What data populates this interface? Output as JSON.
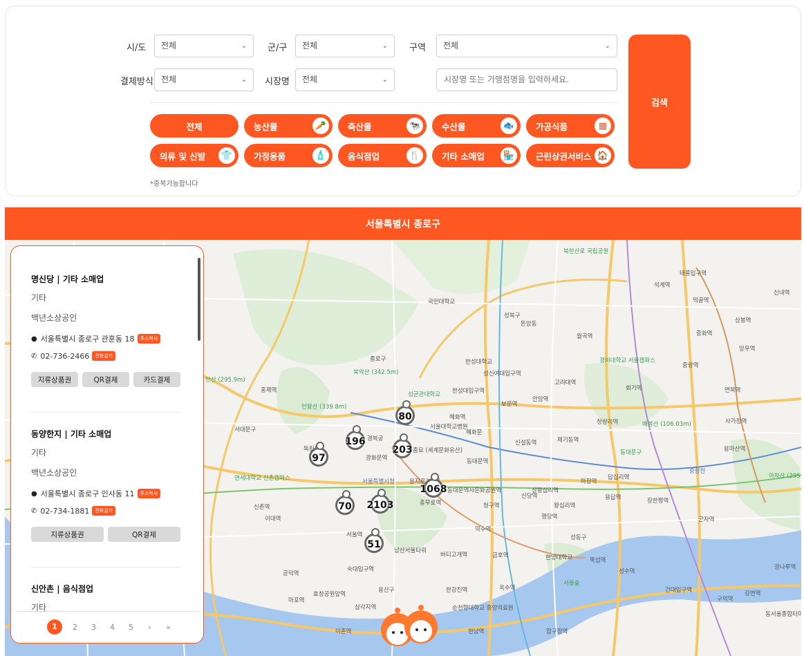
{
  "filters": {
    "sido_label": "시/도",
    "sido_value": "전체",
    "gungu_label": "군/구",
    "gungu_value": "전체",
    "area_label": "구역",
    "area_value": "전체",
    "payment_label": "결제방식",
    "payment_value": "전체",
    "market_label": "시장명",
    "market_value": "전체",
    "search_placeholder": "시장명 또는 가맹점명을 입력하세요.",
    "search_button": "검색",
    "note": "*중복가능합니다"
  },
  "categories": [
    {
      "label": "전체",
      "icon": ""
    },
    {
      "label": "농산물",
      "icon": "vegetable-icon"
    },
    {
      "label": "축산물",
      "icon": "cow-icon"
    },
    {
      "label": "수산물",
      "icon": "fish-icon"
    },
    {
      "label": "가공식품",
      "icon": "package-icon"
    },
    {
      "label": "의류 및 신발",
      "icon": "shirt-icon"
    },
    {
      "label": "가정용품",
      "icon": "bottles-icon"
    },
    {
      "label": "음식점업",
      "icon": "utensils-icon"
    },
    {
      "label": "기타 소매업",
      "icon": "store-icon"
    },
    {
      "label": "근린상권서비스",
      "icon": "house-icon"
    }
  ],
  "region_title": "서울특별시 종로구",
  "stores": [
    {
      "title": "명신당 | 기타 소매업",
      "type": "기타",
      "kind": "백년소상공인",
      "address": "서울특별시 종로구 관훈동 18",
      "copy_badge": "주소복사",
      "phone": "02-736-2466",
      "call_badge": "전화걸기",
      "payments": [
        "지류상품권",
        "QR결제",
        "카드결제"
      ]
    },
    {
      "title": "동양한지 | 기타 소매업",
      "type": "기타",
      "kind": "백년소상공인",
      "address": "서울특별시 종로구 인사동 11",
      "copy_badge": "주소복사",
      "phone": "02-734-1881",
      "call_badge": "전화걸기",
      "payments": [
        "지류상품권",
        "QR결제"
      ]
    },
    {
      "title": "신안촌 | 음식점업",
      "type": "기타"
    }
  ],
  "pagination": {
    "pages": [
      "1",
      "2",
      "3",
      "4",
      "5"
    ],
    "current": "1",
    "next": "›",
    "last": "»"
  },
  "map": {
    "markers": [
      "80",
      "196",
      "203",
      "97",
      "1068",
      "70",
      "2103",
      "51"
    ],
    "labels": {
      "l1": "북한산로 국립공원",
      "l2": "국민대학교",
      "l3": "성북구",
      "l4": "종로구",
      "l5": "북악산 (342.5m)",
      "l6": "인왕산 (339.8m)",
      "l7": "서대문구",
      "l8": "성균관대학교",
      "l9": "혜화역",
      "l10": "경복궁",
      "l11": "종묘 (세계문화유산)",
      "l12": "동대문역",
      "l13": "동대문구",
      "l14": "청량리역",
      "l15": "배봉산 (106.03m)",
      "l16": "회기역",
      "l17": "중랑역",
      "l18": "경희대학교 서울캠퍼스",
      "l19": "고려대역",
      "l20": "안암역",
      "l21": "보문역",
      "l22": "성신여대입구역",
      "l23": "한성대입구역",
      "l24": "서울특별시청",
      "l25": "을지로3가역",
      "l26": "충무로역",
      "l27": "남산서울타워",
      "l28": "용산구",
      "l29": "약수역",
      "l30": "신당역",
      "l31": "왕십리역",
      "l32": "성동구",
      "l33": "한양대학교",
      "l34": "뚝섬역",
      "l35": "서울숲",
      "l36": "한강진역",
      "l37": "금호역",
      "l38": "옥수역",
      "l39": "압구정역",
      "l40": "순천향대학교 중앙의료원",
      "l41": "건대입구역",
      "l42": "구의역",
      "l43": "군자역",
      "l44": "아차산 (295.7m)",
      "l45": "중랑천",
      "l46": "신촌역",
      "l47": "이대역",
      "l48": "연세대학교 신촌캠퍼스",
      "l49": "서울역",
      "l50": "숙대입구역",
      "l51": "공덕역",
      "l52": "효창공원앞역",
      "l53": "삼각지역",
      "l54": "이촌역",
      "l55": "한남역",
      "l56": "광화문역",
      "l57": "독립문",
      "l58": "홍제역",
      "l59": "안산 (295.9m)",
      "l60": "마포역",
      "l61": "용답역",
      "l62": "상왕십리역",
      "l63": "신설동역",
      "l64": "제기동역",
      "l65": "석계역",
      "l66": "태릉입구역",
      "l67": "신내역",
      "l68": "중화역",
      "l69": "상봉역",
      "l70": "망우역",
      "l71": "먹골역",
      "l72": "동대문역사문화공원역",
      "l73": "청구역",
      "l74": "버티고개역",
      "l75": "서울대학교병원",
      "l76": "혜화문",
      "l77": "돈암동",
      "l78": "월곡역",
      "l79": "한성대학교",
      "l80": "장한평역",
      "l81": "답십리역",
      "l82": "마장역",
      "l83": "행당역",
      "l84": "성수역",
      "l85": "용마산역",
      "l86": "사가정역",
      "l87": "면목역",
      "l88": "광나루역",
      "l89": "동서울종합터미널",
      "l90": "강변역"
    }
  }
}
